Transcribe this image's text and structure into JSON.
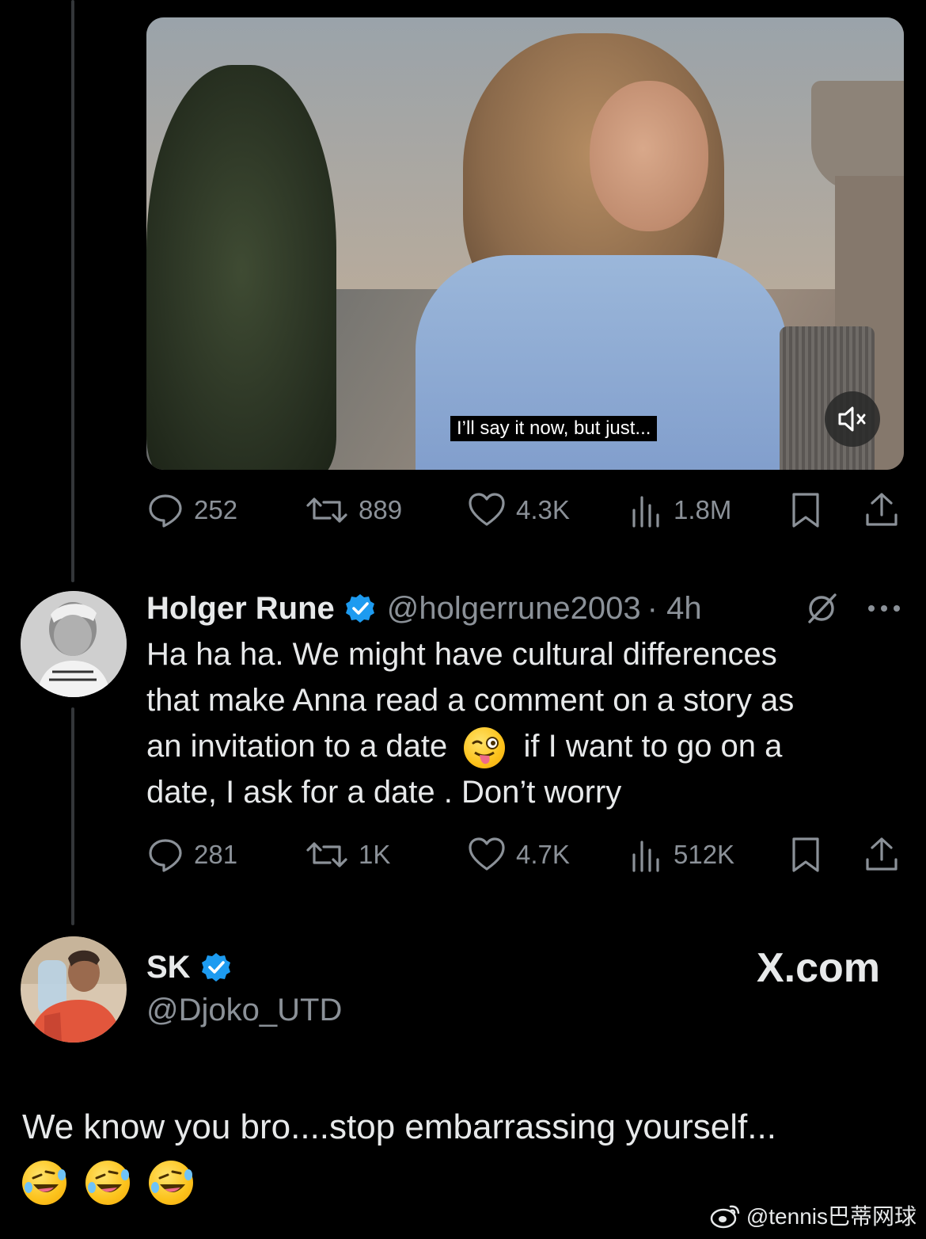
{
  "video": {
    "caption": "I’ll say it now, but just..."
  },
  "tweet1_actions": {
    "replies": "252",
    "reposts": "889",
    "likes": "4.3K",
    "views": "1.8M"
  },
  "reply": {
    "name": "Holger Rune",
    "handle": "@holgerrune2003",
    "time": "· 4h",
    "line1": "Ha ha ha. We might have cultural differences",
    "line2": "that make Anna read a comment on a story as",
    "line3a": "an invitation to a date",
    "line3b": "if I want to go on a",
    "line4": "date, I ask for a date . Don’t worry",
    "actions": {
      "replies": "281",
      "reposts": "1K",
      "likes": "4.7K",
      "views": "512K"
    }
  },
  "quote": {
    "name": "SK",
    "handle": "@Djoko_UTD",
    "brand": "X.com",
    "text": "We know you bro....stop embarrassing yourself..."
  },
  "watermark": "@tennis巴蒂网球"
}
